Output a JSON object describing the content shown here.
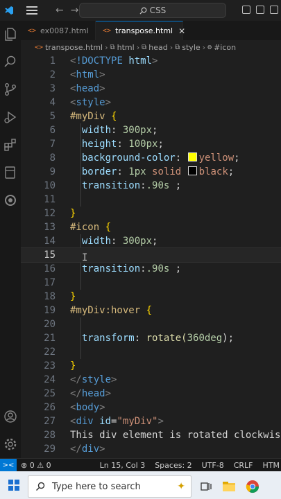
{
  "titlebar": {
    "search_text": "CSS",
    "nav_arrows": "←→"
  },
  "tabs": [
    {
      "label": "ex0087.html",
      "icon": "<>",
      "active": false
    },
    {
      "label": "transpose.html",
      "icon": "<>",
      "active": true,
      "close": "✕"
    }
  ],
  "breadcrumb": {
    "file": "transpose.html",
    "items": [
      "html",
      "head",
      "style",
      "#icon"
    ]
  },
  "editor": {
    "current_line": 15,
    "lines": [
      {
        "n": "1"
      },
      {
        "n": "2"
      },
      {
        "n": "3"
      },
      {
        "n": "4"
      },
      {
        "n": "5"
      },
      {
        "n": "6"
      },
      {
        "n": "7"
      },
      {
        "n": "8"
      },
      {
        "n": "9"
      },
      {
        "n": "10"
      },
      {
        "n": "11"
      },
      {
        "n": "12"
      },
      {
        "n": "13"
      },
      {
        "n": "14"
      },
      {
        "n": "15"
      },
      {
        "n": "16"
      },
      {
        "n": "17"
      },
      {
        "n": "18"
      },
      {
        "n": "19"
      },
      {
        "n": "20"
      },
      {
        "n": "21"
      },
      {
        "n": "22"
      },
      {
        "n": "23"
      },
      {
        "n": "24"
      },
      {
        "n": "25"
      },
      {
        "n": "26"
      },
      {
        "n": "27"
      },
      {
        "n": "28"
      },
      {
        "n": "29"
      }
    ],
    "tokens": {
      "doctype": "!DOCTYPE",
      "html": "html",
      "head": "head",
      "style": "style",
      "mydiv_sel": "#myDiv",
      "width": "width",
      "w300": "300px",
      "height": "height",
      "h100": "100px",
      "bgcolor": "background-color",
      "yellow": "yellow",
      "border": "border",
      "border_val_num": "1px",
      "border_val_solid": "solid",
      "black": "black",
      "transition": "transition",
      "t90": ".90s",
      "icon_sel": "#icon",
      "hover_sel": "#myDiv:hover",
      "transform": "transform",
      "rotate": "rotate(",
      "deg": "360deg",
      "rparen": ")",
      "body": "body",
      "div": "div",
      "id_attr": "id",
      "id_val": "\"myDiv\"",
      "div_text": "This div element is rotated clockwise"
    }
  },
  "statusbar": {
    "errors": "0",
    "warnings": "0",
    "position": "Ln 15, Col 3",
    "spaces": "Spaces: 2",
    "encoding": "UTF-8",
    "eol": "CRLF",
    "language": "HTM"
  },
  "taskbar": {
    "search_placeholder": "Type here to search"
  },
  "colors": {
    "accent": "#0078d4",
    "swatch_yellow": "#ffff00",
    "swatch_black": "#000000"
  }
}
